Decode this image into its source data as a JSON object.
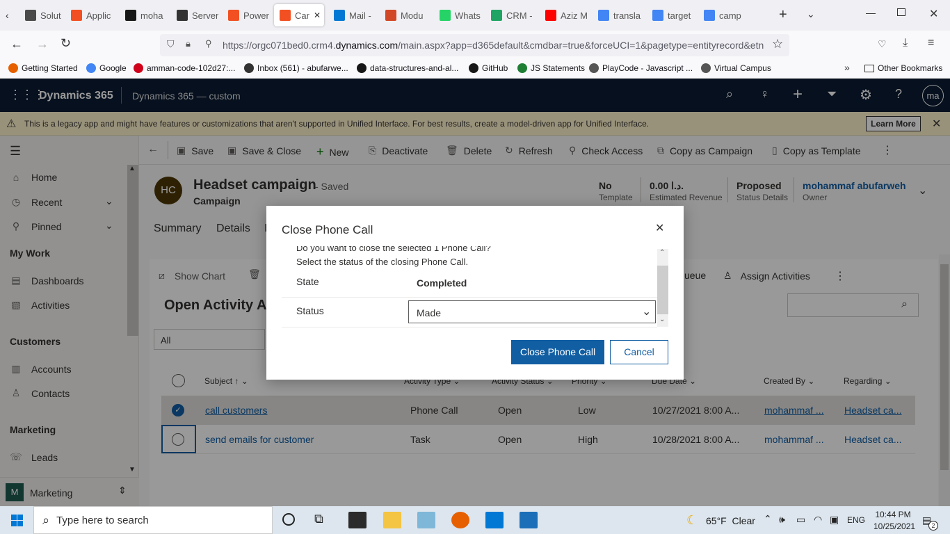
{
  "browser": {
    "tabs": [
      {
        "label": "Soluti",
        "color": "#4a4a4a"
      },
      {
        "label": "Applic",
        "color": "#f25022"
      },
      {
        "label": "moha",
        "color": "#181717"
      },
      {
        "label": "Server",
        "color": "#333333"
      },
      {
        "label": "Power",
        "color": "#f25022"
      },
      {
        "label": "Car",
        "color": "#f25022"
      },
      {
        "label": "Mail -",
        "color": "#0078d4"
      },
      {
        "label": "Modu",
        "color": "#d24726"
      },
      {
        "label": "Whats",
        "color": "#25d366"
      },
      {
        "label": "CRM -",
        "color": "#1fa463"
      },
      {
        "label": "Aziz M",
        "color": "#ff0000"
      },
      {
        "label": "transla",
        "color": "#4285f4"
      },
      {
        "label": "target",
        "color": "#4285f4"
      },
      {
        "label": "camp",
        "color": "#4285f4"
      }
    ],
    "url_prefix": "https://orgc071bed0.crm4.",
    "url_domain": "dynamics.com",
    "url_rest": "/main.aspx?app=d365default&cmdbar=true&forceUCI=1&pagetype=entityrecord&etn",
    "bookmarks": [
      "Getting Started",
      "Google",
      "amman-code-102d27:...",
      "Inbox (561) - abufarwe...",
      "data-structures-and-al...",
      "GitHub",
      "JS Statements",
      "PlayCode - Javascript ...",
      "Virtual Campus"
    ],
    "other_bookmarks": "Other Bookmarks"
  },
  "app": {
    "name": "Dynamics 365",
    "area": "Dynamics 365 — custom",
    "avatar": "ma",
    "legacy_notice": "This is a legacy app and might have features or customizations that aren't supported in Unified Interface. For best results, create a model-driven app for Unified Interface.",
    "learn_more": "Learn More"
  },
  "sidebar": {
    "items": [
      {
        "label": "Home"
      },
      {
        "label": "Recent"
      },
      {
        "label": "Pinned"
      }
    ],
    "my_work": "My Work",
    "work_items": [
      "Dashboards",
      "Activities"
    ],
    "customers": "Customers",
    "customer_items": [
      "Accounts",
      "Contacts"
    ],
    "marketing": "Marketing",
    "marketing_items": [
      "Leads"
    ],
    "area_switch_initial": "M",
    "area_switch_label": "Marketing"
  },
  "commands": [
    "Save",
    "Save & Close",
    "New",
    "Deactivate",
    "Delete",
    "Refresh",
    "Check Access",
    "Copy as Campaign",
    "Copy as Template"
  ],
  "record": {
    "initials": "HC",
    "title": "Headset campaign",
    "saved": "- Saved",
    "entity": "Campaign",
    "header_fields": [
      {
        "value": "No",
        "label": "Template"
      },
      {
        "value": "0.00 د.ا.",
        "label": "Estimated Revenue"
      },
      {
        "value": "Proposed",
        "label": "Status Details"
      },
      {
        "value": "mohammaf abufarweh",
        "label": "Owner"
      }
    ],
    "tabs": [
      "Summary",
      "Details",
      "I"
    ]
  },
  "subgrid": {
    "show_chart": "Show Chart",
    "title": "Open Activity A",
    "view": "All",
    "queue": "ueue",
    "assign": "Assign Activities",
    "columns": [
      "Subject ↑",
      "Activity Type",
      "Activity Status",
      "Priority",
      "Due Date",
      "Created By",
      "Regarding"
    ],
    "rows": [
      {
        "subject": "call customers",
        "type": "Phone Call",
        "status": "Open",
        "priority": "Low",
        "due": "10/27/2021 8:00 A...",
        "created_by": "mohammaf ...",
        "regarding": "Headset ca...",
        "selected": true
      },
      {
        "subject": "send emails for customer",
        "type": "Task",
        "status": "Open",
        "priority": "High",
        "due": "10/28/2021 8:00 A...",
        "created_by": "mohammaf ...",
        "regarding": "Headset ca...",
        "selected": false
      }
    ]
  },
  "dialog": {
    "title": "Close Phone Call",
    "line1": "Do you want to close the selected 1 Phone Call?",
    "line2": "Select the status of the closing Phone Call.",
    "state_label": "State",
    "state_value": "Completed",
    "status_label": "Status",
    "status_value": "Made",
    "confirm": "Close Phone Call",
    "cancel": "Cancel"
  },
  "taskbar": {
    "search_placeholder": "Type here to search",
    "weather": "65°F  Clear",
    "lang": "ENG",
    "time": "10:44 PM",
    "date": "10/25/2021",
    "notifications": "2"
  }
}
